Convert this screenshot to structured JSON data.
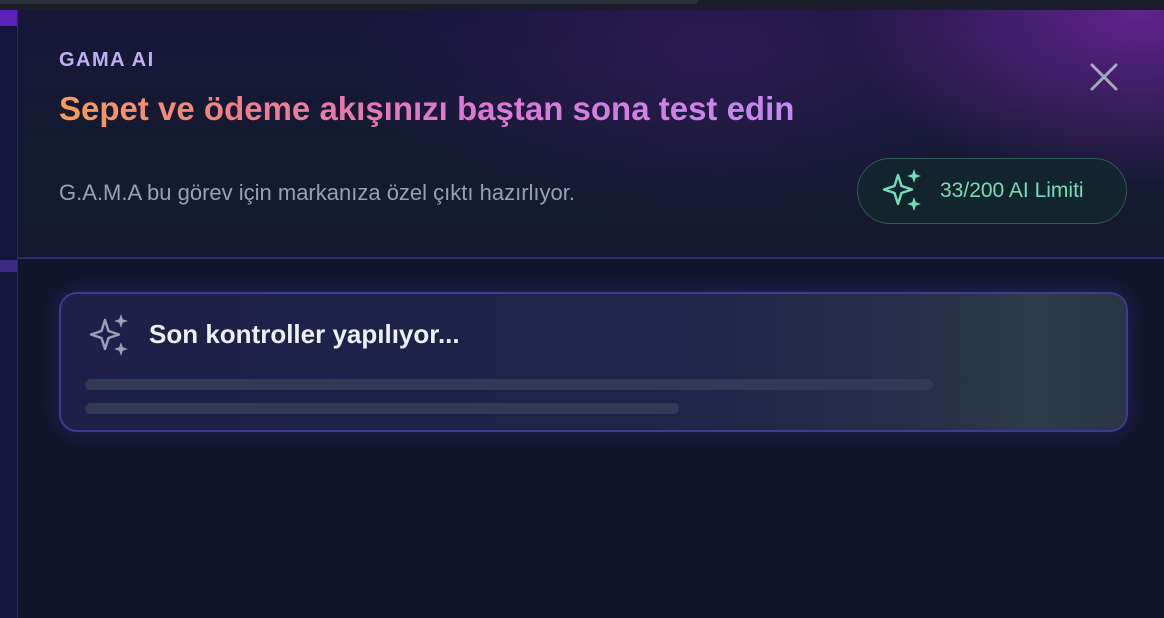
{
  "header": {
    "eyebrow": "GAMA AI",
    "title": "Sepet ve ödeme akışınızı baştan sona test edin",
    "subtitle": "G.A.M.A bu görev için markanıza özel çıktı hazırlıyor.",
    "close_icon": "close-icon"
  },
  "ai_limit": {
    "label": "33/200 AI Limiti",
    "used": 33,
    "total": 200,
    "icon": "sparkles-icon",
    "color": "#77ddb8"
  },
  "loading_card": {
    "status_text": "Son kontroller yapılıyor...",
    "icon": "sparkles-icon"
  },
  "colors": {
    "title_gradient_start": "#f59e5a",
    "title_gradient_end": "#c28af0",
    "eyebrow": "#c0b0f2",
    "accent_green": "#77ddb8"
  }
}
